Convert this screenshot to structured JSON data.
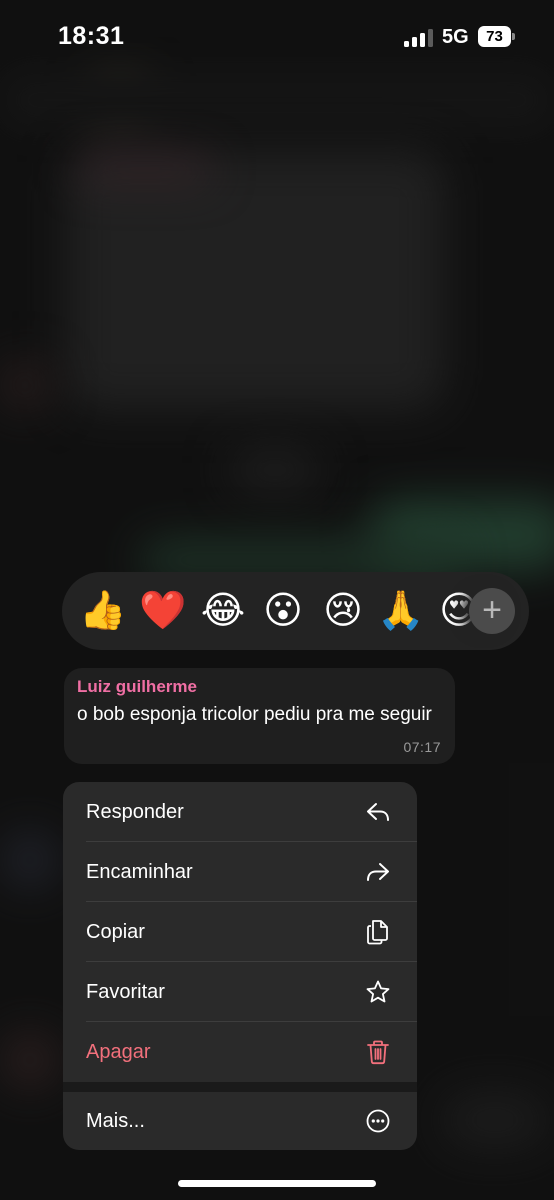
{
  "status_bar": {
    "time": "18:31",
    "network": "5G",
    "battery": "73"
  },
  "reactions": {
    "emojis": [
      {
        "glyph": "👍",
        "name": "thumbs-up"
      },
      {
        "glyph": "❤️",
        "name": "red-heart"
      },
      {
        "glyph": "😂",
        "name": "tears-of-joy"
      },
      {
        "glyph": "😮",
        "name": "surprised"
      },
      {
        "glyph": "😢",
        "name": "crying"
      },
      {
        "glyph": "🙏",
        "name": "folded-hands"
      },
      {
        "glyph": "😍",
        "name": "heart-eyes"
      }
    ],
    "more_icon": "plus-icon"
  },
  "message": {
    "sender": "Luiz guilherme",
    "text": "o bob esponja tricolor pediu pra me seguir",
    "time": "07:17",
    "sender_color": "#f06fa4"
  },
  "menu": {
    "items": [
      {
        "label": "Responder",
        "icon": "reply-icon"
      },
      {
        "label": "Encaminhar",
        "icon": "forward-icon"
      },
      {
        "label": "Copiar",
        "icon": "copy-icon"
      },
      {
        "label": "Favoritar",
        "icon": "star-icon"
      },
      {
        "label": "Apagar",
        "icon": "trash-icon",
        "danger": true
      }
    ],
    "more": {
      "label": "Mais...",
      "icon": "more-icon"
    },
    "danger_color": "#f2707c"
  }
}
